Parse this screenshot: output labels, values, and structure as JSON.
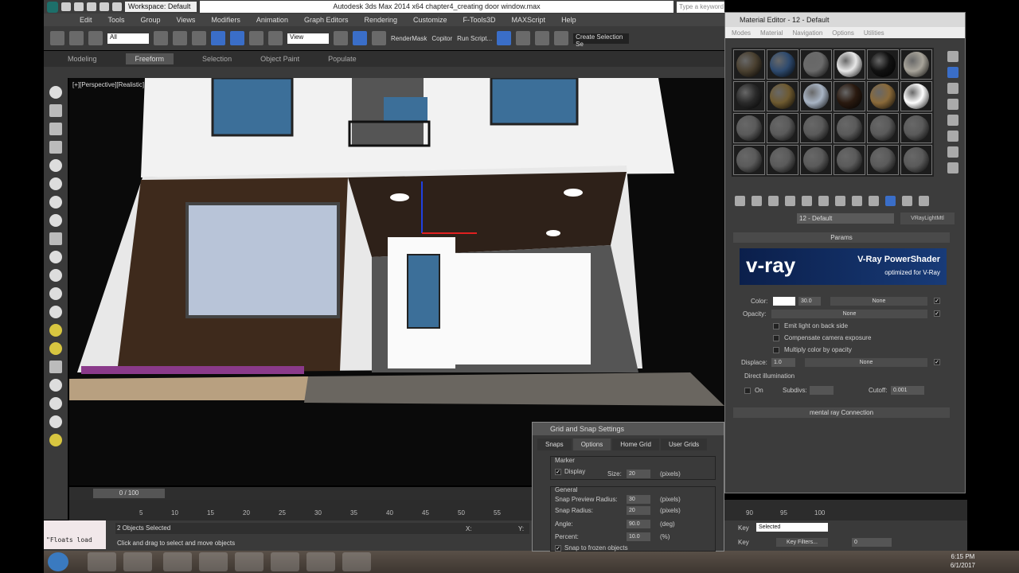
{
  "title_bar": {
    "workspace": "Workspace: Default",
    "title": "Autodesk 3ds Max 2014 x64     chapter4_creating door window.max",
    "search_placeholder": "Type a keyword or phrase"
  },
  "menu": [
    "Edit",
    "Tools",
    "Group",
    "Views",
    "Modifiers",
    "Animation",
    "Graph Editors",
    "Rendering",
    "Customize",
    "F-Tools3D",
    "MAXScript",
    "Help"
  ],
  "toolbar": {
    "selection_filter": "All",
    "ref_coord": "View",
    "render_mask": "RenderMask",
    "copitor": "Copitor",
    "run_script": "Run Script...",
    "named_selection": "Create Selection Se"
  },
  "ribbon": {
    "tabs": [
      "Modeling",
      "Freeform",
      "Selection",
      "Object Paint",
      "Populate"
    ],
    "active": "Freeform"
  },
  "viewport": {
    "label": "[+][Perspective][Realistic]"
  },
  "timeline": {
    "slider": "0 / 100",
    "ticks": [
      "5",
      "10",
      "15",
      "20",
      "25",
      "30",
      "35",
      "40",
      "45",
      "50",
      "55",
      "90",
      "95",
      "100"
    ]
  },
  "status": {
    "listener": "\"Floats load",
    "selection": "2 Objects Selected",
    "prompt": "Click and drag to select and move objects",
    "x_label": "X:",
    "y_label": "Y:"
  },
  "anim": {
    "key_mode": "Selected",
    "key_filters": "Key Filters...",
    "set_key": "Key",
    "auto_key": "Key",
    "frame": "0"
  },
  "clock": {
    "time": "6:15 PM",
    "date": "6/1/2017"
  },
  "material_editor": {
    "title": "Material Editor - 12 - Default",
    "menu": [
      "Modes",
      "Material",
      "Navigation",
      "Options",
      "Utilities"
    ],
    "slot_colors": [
      "#4a4030",
      "#2e4a6e",
      "#6a6a6a",
      "#e8e8e8",
      "#111111",
      "#a8a49a",
      "#2a2a2a",
      "#6e5a30",
      "#a8b4c4",
      "#2a1a10",
      "#8a6a3a",
      "#ffffff",
      "#5a5a5a",
      "#5a5a5a",
      "#5a5a5a",
      "#5a5a5a",
      "#5a5a5a",
      "#5a5a5a",
      "#5a5a5a",
      "#5a5a5a",
      "#5a5a5a",
      "#5a5a5a",
      "#5a5a5a",
      "#5a5a5a"
    ],
    "material_name": "12 - Default",
    "material_type": "VRayLightMtl",
    "params_rollout": "Params",
    "vray_logo": "v-ray",
    "vray_title": "V-Ray PowerShader",
    "vray_subtitle": "optimized for V-Ray",
    "color_label": "Color:",
    "color_value": "30.0",
    "color_map": "None",
    "opacity_label": "Opacity:",
    "opacity_map": "None",
    "emit_back": "Emit light on back side",
    "compensate": "Compensate camera exposure",
    "multiply": "Multiply color by opacity",
    "displace_label": "Displace:",
    "displace_value": "1.0",
    "displace_map": "None",
    "direct_group": "Direct illumination",
    "on_label": "On",
    "subdivs_label": "Subdivs:",
    "cutoff_label": "Cutoff:",
    "cutoff_value": "0.001",
    "mr_rollout": "mental ray Connection"
  },
  "grid_snap": {
    "title": "Grid and Snap Settings",
    "tabs": [
      "Snaps",
      "Options",
      "Home Grid",
      "User Grids"
    ],
    "active_tab": "Options",
    "marker_group": "Marker",
    "display": "Display",
    "size_label": "Size:",
    "size_value": "20",
    "pixels": "(pixels)",
    "general_group": "General",
    "preview_radius_label": "Snap Preview Radius:",
    "preview_radius": "30",
    "snap_radius_label": "Snap Radius:",
    "snap_radius": "20",
    "angle_label": "Angle:",
    "angle": "90.0",
    "deg": "(deg)",
    "percent_label": "Percent:",
    "percent": "10.0",
    "pct": "(%)",
    "snap_frozen": "Snap to frozen objects"
  }
}
